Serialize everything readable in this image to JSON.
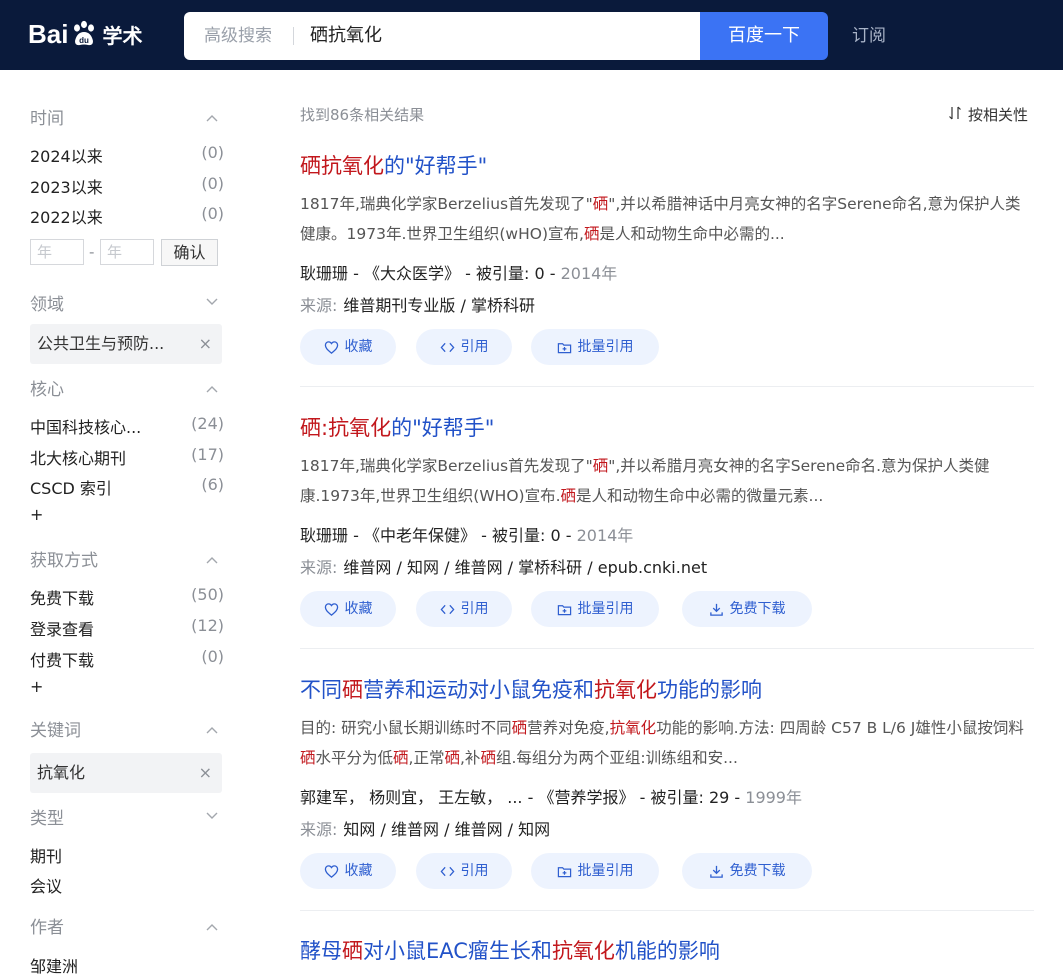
{
  "header": {
    "logo_text": "Bai",
    "logo_text2": "学术",
    "advanced_search": "高级搜索",
    "query": "硒抗氧化",
    "search_button": "百度一下",
    "subscribe": "订阅"
  },
  "sidebar": {
    "time": {
      "title": "时间",
      "items": [
        {
          "label": "2024以来",
          "count": "(0)"
        },
        {
          "label": "2023以来",
          "count": "(0)"
        },
        {
          "label": "2022以来",
          "count": "(0)"
        }
      ],
      "year_from_placeholder": "年",
      "year_to_placeholder": "年",
      "dash": "-",
      "confirm": "确认"
    },
    "field": {
      "title": "领域",
      "chip": "公共卫生与预防...",
      "chip_close": "×"
    },
    "core": {
      "title": "核心",
      "items": [
        {
          "label": "中国科技核心...",
          "count": "(24)"
        },
        {
          "label": "北大核心期刊",
          "count": "(17)"
        },
        {
          "label": "CSCD 索引",
          "count": "(6)"
        }
      ],
      "more": "+"
    },
    "access": {
      "title": "获取方式",
      "items": [
        {
          "label": "免费下载",
          "count": "(50)"
        },
        {
          "label": "登录查看",
          "count": "(12)"
        },
        {
          "label": "付费下载",
          "count": "(0)"
        }
      ],
      "more": "+"
    },
    "keyword": {
      "title": "关键词",
      "chip": "抗氧化",
      "chip_close": "×"
    },
    "type": {
      "title": "类型",
      "items": [
        "期刊",
        "会议"
      ]
    },
    "author": {
      "title": "作者",
      "items": [
        "邹建洲"
      ]
    }
  },
  "results_header": {
    "found": "找到86条相关结果",
    "sort": "按相关性"
  },
  "actions": {
    "collect": "收藏",
    "cite": "引用",
    "batch_cite": "批量引用",
    "download": "免费下载"
  },
  "results": [
    {
      "title_parts": [
        {
          "t": "硒抗氧化",
          "h": true
        },
        {
          "t": "的\"好帮手\"",
          "h": false
        }
      ],
      "abstract_parts": [
        {
          "t": "1817年,瑞典化学家Berzelius首先发现了\"",
          "h": false
        },
        {
          "t": "硒",
          "h": true
        },
        {
          "t": "\",并以希腊神话中月亮女神的名字Serene命名,意为保护人类健康。1973年.世界卫生组织(wHO)宣布,",
          "h": false
        },
        {
          "t": "硒",
          "h": true
        },
        {
          "t": "是人和动物生命中必需的...",
          "h": false
        }
      ],
      "meta": {
        "author": "耿珊珊",
        "journal": "《大众医学》",
        "cited_label": "被引量:",
        "cited": "0",
        "year": "2014年"
      },
      "source_label": "来源:",
      "sources": [
        "维普期刊专业版",
        "掌桥科研"
      ]
    },
    {
      "title_parts": [
        {
          "t": "硒:抗氧化",
          "h": true
        },
        {
          "t": "的\"好帮手\"",
          "h": false
        }
      ],
      "abstract_parts": [
        {
          "t": "1817年,瑞典化学家Berzelius首先发现了\"",
          "h": false
        },
        {
          "t": "硒",
          "h": true
        },
        {
          "t": "\",并以希腊月亮女神的名字Serene命名.意为保护人类健康.1973年,世界卫生组织(WHO)宣布.",
          "h": false
        },
        {
          "t": "硒",
          "h": true
        },
        {
          "t": "是人和动物生命中必需的微量元素...",
          "h": false
        }
      ],
      "meta": {
        "author": "耿珊珊",
        "journal": "《中老年保健》",
        "cited_label": "被引量:",
        "cited": "0",
        "year": "2014年"
      },
      "source_label": "来源:",
      "sources": [
        "维普网",
        "知网",
        "维普网",
        "掌桥科研",
        "epub.cnki.net"
      ]
    },
    {
      "title_parts": [
        {
          "t": "不同",
          "h": false
        },
        {
          "t": "硒",
          "h": true
        },
        {
          "t": "营养和运动对小鼠免疫和",
          "h": false
        },
        {
          "t": "抗氧化",
          "h": true
        },
        {
          "t": "功能的影响",
          "h": false
        }
      ],
      "abstract_parts": [
        {
          "t": "目的: 研究小鼠长期训练时不同",
          "h": false
        },
        {
          "t": "硒",
          "h": true
        },
        {
          "t": "营养对免疫,",
          "h": false
        },
        {
          "t": "抗氧化",
          "h": true
        },
        {
          "t": "功能的影响.方法: 四周龄 C57 B L/6 J雄性小鼠按饲料",
          "h": false
        },
        {
          "t": "硒",
          "h": true
        },
        {
          "t": "水平分为低",
          "h": false
        },
        {
          "t": "硒",
          "h": true
        },
        {
          "t": ",正常",
          "h": false
        },
        {
          "t": "硒",
          "h": true
        },
        {
          "t": ",补",
          "h": false
        },
        {
          "t": "硒",
          "h": true
        },
        {
          "t": "组.每组分为两个亚组:训练组和安...",
          "h": false
        }
      ],
      "meta": {
        "author": "郭建军， 杨则宜， 王左敏， ...",
        "journal": "《营养学报》",
        "cited_label": "被引量:",
        "cited": "29",
        "year": "1999年"
      },
      "source_label": "来源:",
      "sources": [
        "知网",
        "维普网",
        "维普网",
        "知网"
      ]
    },
    {
      "title_parts": [
        {
          "t": "酵母",
          "h": false
        },
        {
          "t": "硒",
          "h": true
        },
        {
          "t": "对小鼠EAC瘤生长和",
          "h": false
        },
        {
          "t": "抗氧化",
          "h": true
        },
        {
          "t": "机能的影响",
          "h": false
        }
      ]
    }
  ]
}
